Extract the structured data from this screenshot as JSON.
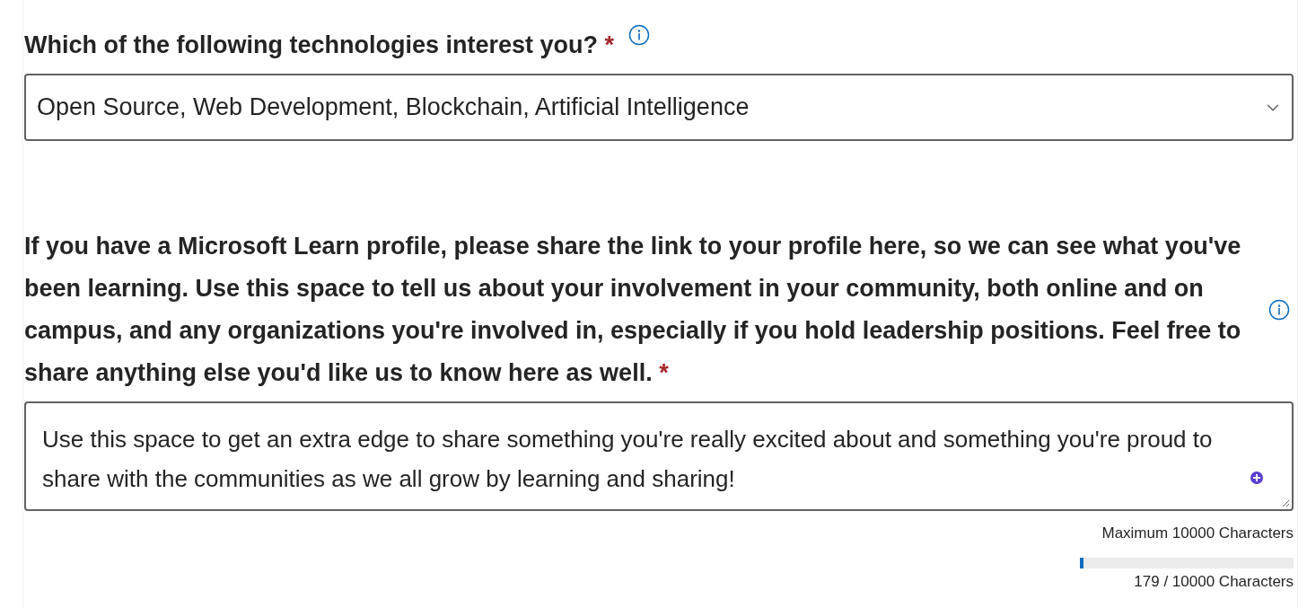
{
  "questions": [
    {
      "kind": "dropdown",
      "label": "Which of the following technologies interest you?",
      "required": true,
      "required_mark": "*",
      "value": "Open Source, Web Development, Blockchain, Artificial Intelligence"
    },
    {
      "kind": "textarea",
      "label": "If you have a Microsoft Learn profile, please share the link to your profile here, so we can see what you've been learning. Use this space to tell us about your involvement in your community, both online and on campus, and any organizations you're involved in, especially if you hold leadership positions. Feel free to share anything else you'd like us to know here as well.",
      "required": true,
      "required_mark": "*",
      "value": "Use this space to get an extra edge to share something you're really excited about and something you're proud to share with the communities as we all grow by learning and sharing!",
      "limit": "Maximum 10000 Characters",
      "level": 0.018,
      "count": "179 / 10000 Characters"
    }
  ]
}
